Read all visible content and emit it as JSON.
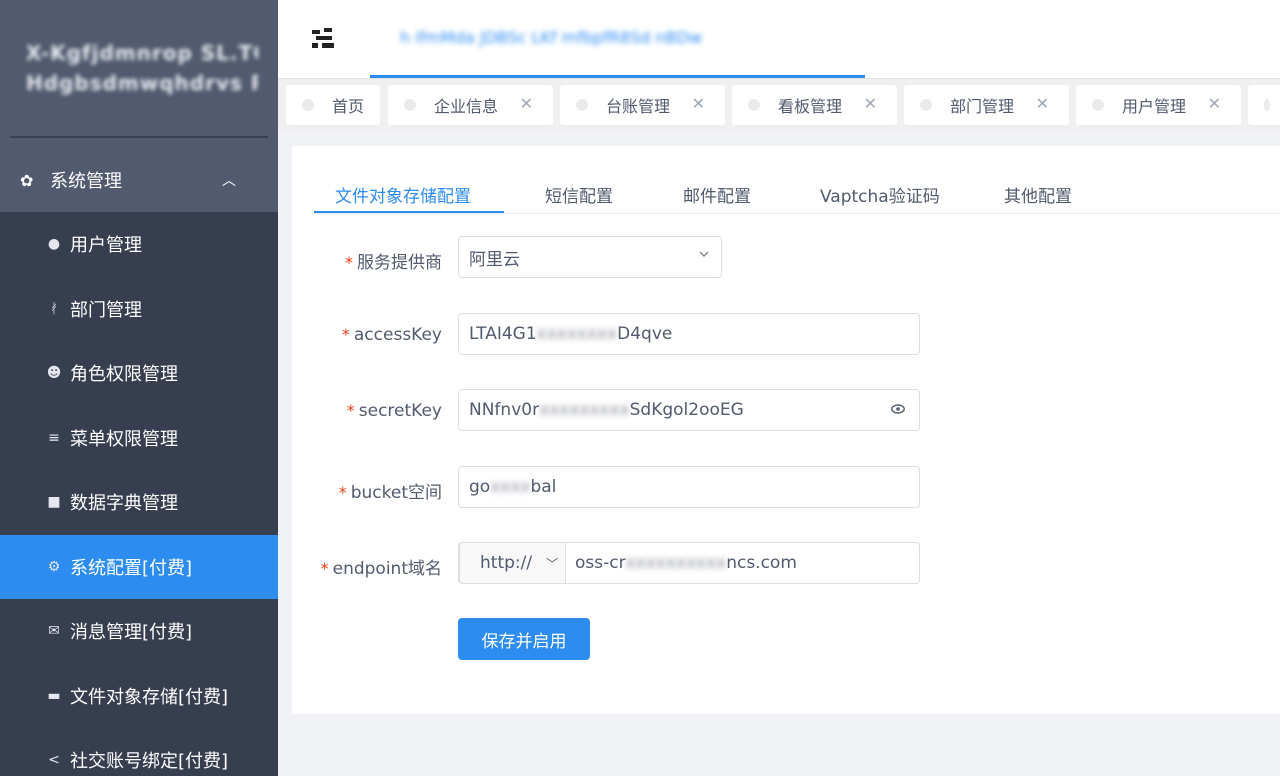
{
  "sidebar": {
    "logo_line1": "X-Kgfjdmnrop SL.TC",
    "logo_line2": "Hdgbsdmwqhdrvs RM",
    "group": {
      "label": "系统管理",
      "icon": "gear-icon"
    },
    "items": [
      {
        "label": "用户管理",
        "icon": "user-icon",
        "active": false
      },
      {
        "label": "部门管理",
        "icon": "branch-icon",
        "active": false
      },
      {
        "label": "角色权限管理",
        "icon": "users-icon",
        "active": false
      },
      {
        "label": "菜单权限管理",
        "icon": "menu-icon",
        "active": false
      },
      {
        "label": "数据字典管理",
        "icon": "book-icon",
        "active": false
      },
      {
        "label": "系统配置[付费]",
        "icon": "settings-icon",
        "active": true
      },
      {
        "label": "消息管理[付费]",
        "icon": "mail-icon",
        "active": false
      },
      {
        "label": "文件对象存储[付费]",
        "icon": "folder-icon",
        "active": false
      },
      {
        "label": "社交账号绑定[付费]",
        "icon": "share-icon",
        "active": false
      }
    ]
  },
  "header": {
    "breadcrumb": "h ifmMda JDBSc LKf mfbpfR8Sd nBDw"
  },
  "tags": [
    {
      "label": "首页",
      "closable": false
    },
    {
      "label": "企业信息",
      "closable": true
    },
    {
      "label": "台账管理",
      "closable": true
    },
    {
      "label": "看板管理",
      "closable": true
    },
    {
      "label": "部门管理",
      "closable": true
    },
    {
      "label": "用户管理",
      "closable": true
    }
  ],
  "tabs": [
    {
      "label": "文件对象存储配置",
      "active": true
    },
    {
      "label": "短信配置",
      "active": false
    },
    {
      "label": "邮件配置",
      "active": false
    },
    {
      "label": "Vaptcha验证码",
      "active": false
    },
    {
      "label": "其他配置",
      "active": false
    }
  ],
  "form": {
    "provider": {
      "label": "服务提供商",
      "value": "阿里云"
    },
    "access_key": {
      "label": "accessKey",
      "prefix": "LTAI4G1",
      "masked": "xxxxxxxx",
      "suffix": "D4qve"
    },
    "secret_key": {
      "label": "secretKey",
      "prefix": "NNfnv0r",
      "masked": "xxxxxxxxx",
      "suffix": "SdKgol2ooEG"
    },
    "bucket": {
      "label": "bucket空间",
      "prefix": "go",
      "masked": "xxxx",
      "suffix": "bal"
    },
    "endpoint": {
      "label": "endpoint域名",
      "protocol": "http://",
      "prefix": "oss-cr",
      "masked": "xxxxxxxxxx",
      "suffix": "ncs.com"
    },
    "submit_label": "保存并启用"
  },
  "colors": {
    "primary": "#2d8cf0",
    "sidebar": "#515a6e",
    "submenu": "#363e4f",
    "required": "#ed4014"
  }
}
